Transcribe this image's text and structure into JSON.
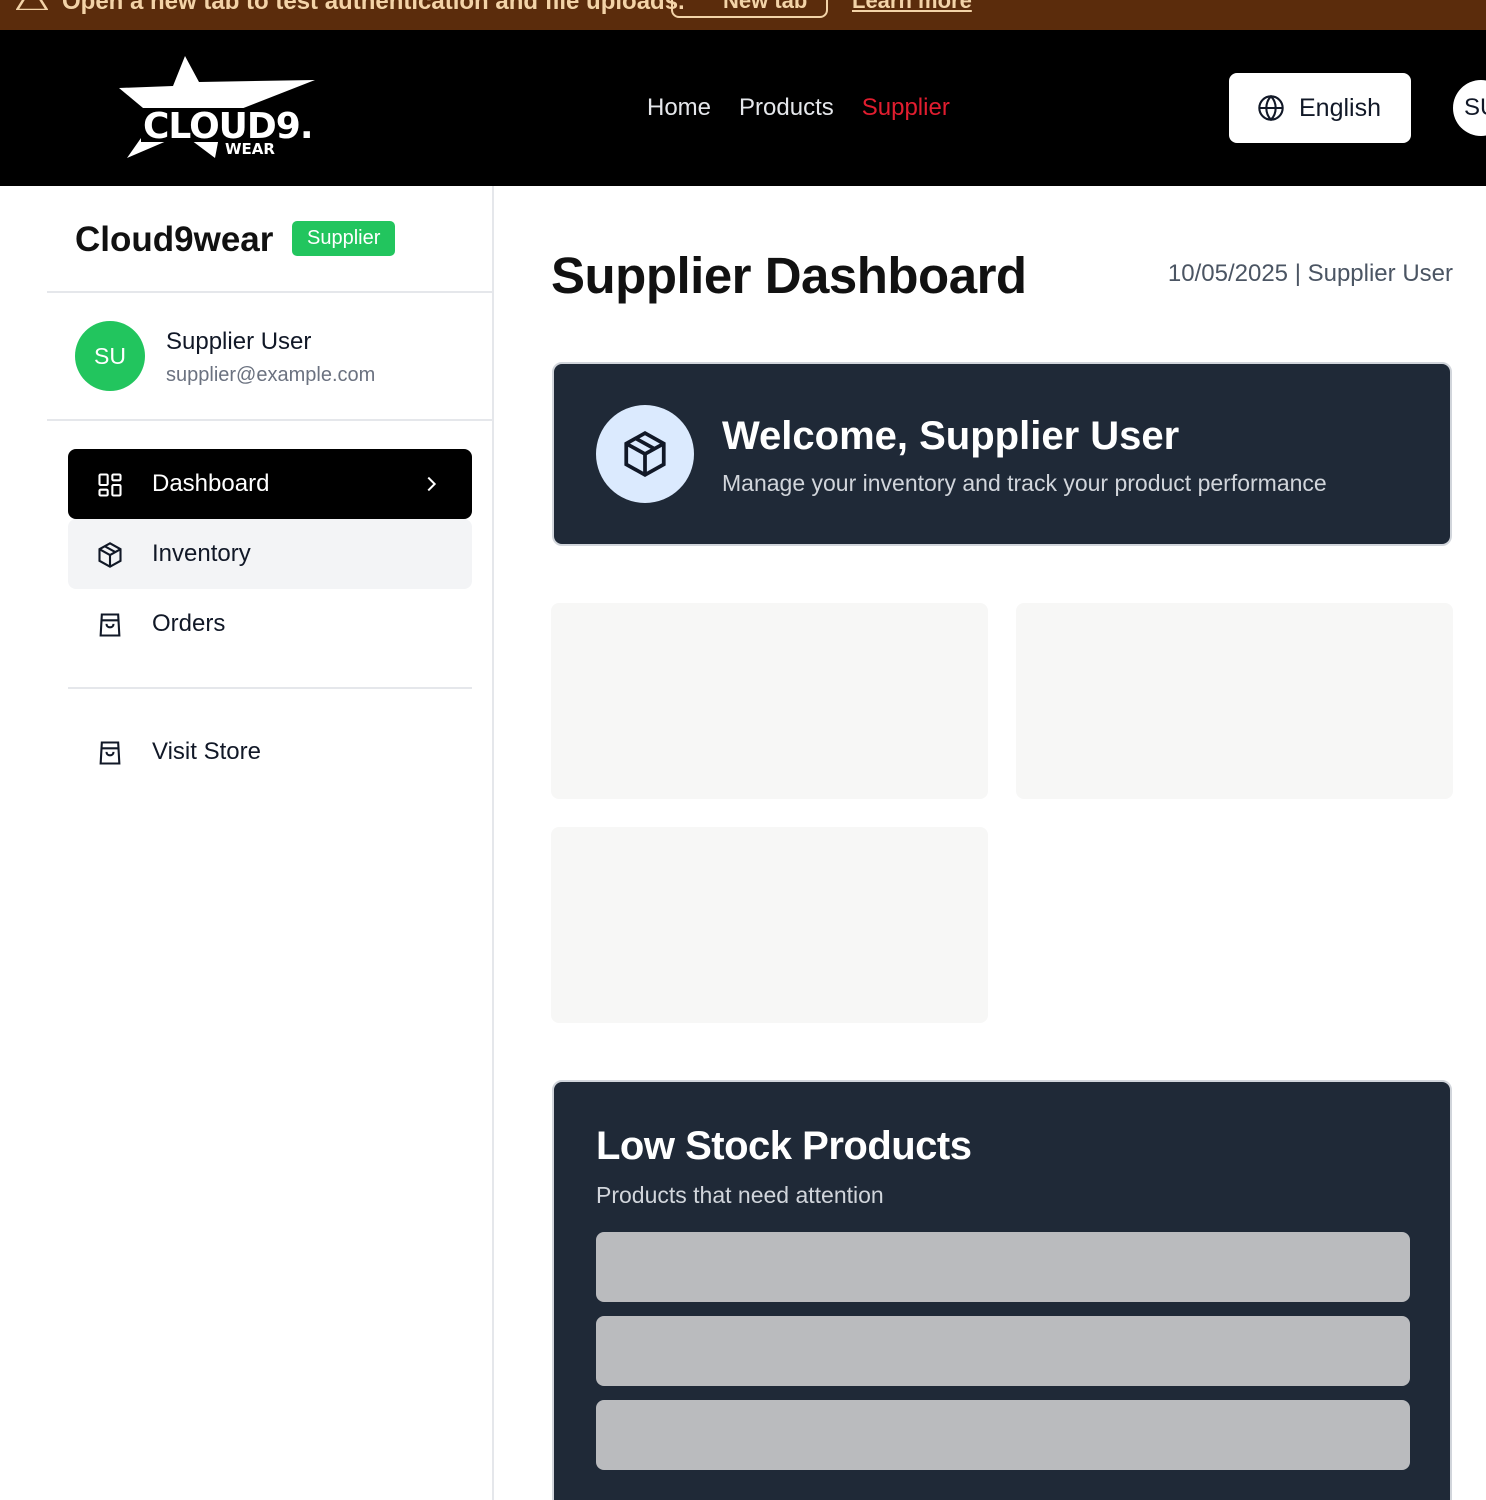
{
  "banner": {
    "message": "Open a new tab to test authentication and file uploads.",
    "button_label": "New tab",
    "link_label": "Learn more"
  },
  "header": {
    "logo_icon": "cloud9-wear-logo",
    "logo_text_main": "CLOUD9.",
    "logo_text_sub": "WEAR",
    "nav": [
      {
        "label": "Home",
        "active": false
      },
      {
        "label": "Products",
        "active": false
      },
      {
        "label": "Supplier",
        "active": true
      }
    ],
    "language_label": "English",
    "avatar_initials": "SU",
    "accent_color": "#e11d2f"
  },
  "sidebar": {
    "brand": "Cloud9wear",
    "role_badge": "Supplier",
    "user": {
      "initials": "SU",
      "name": "Supplier User",
      "email": "supplier@example.com"
    },
    "menu": [
      {
        "label": "Dashboard",
        "icon": "dashboard-icon"
      },
      {
        "label": "Inventory",
        "icon": "package-icon"
      },
      {
        "label": "Orders",
        "icon": "shopping-bag-icon"
      }
    ],
    "visit_store_label": "Visit Store"
  },
  "main": {
    "title": "Supplier Dashboard",
    "meta": "10/05/2025 | Supplier User",
    "welcome": {
      "title": "Welcome, Supplier User",
      "subtitle": "Manage your inventory and track your product performance"
    },
    "low_stock": {
      "title": "Low Stock Products",
      "subtitle": "Products that need attention"
    }
  }
}
